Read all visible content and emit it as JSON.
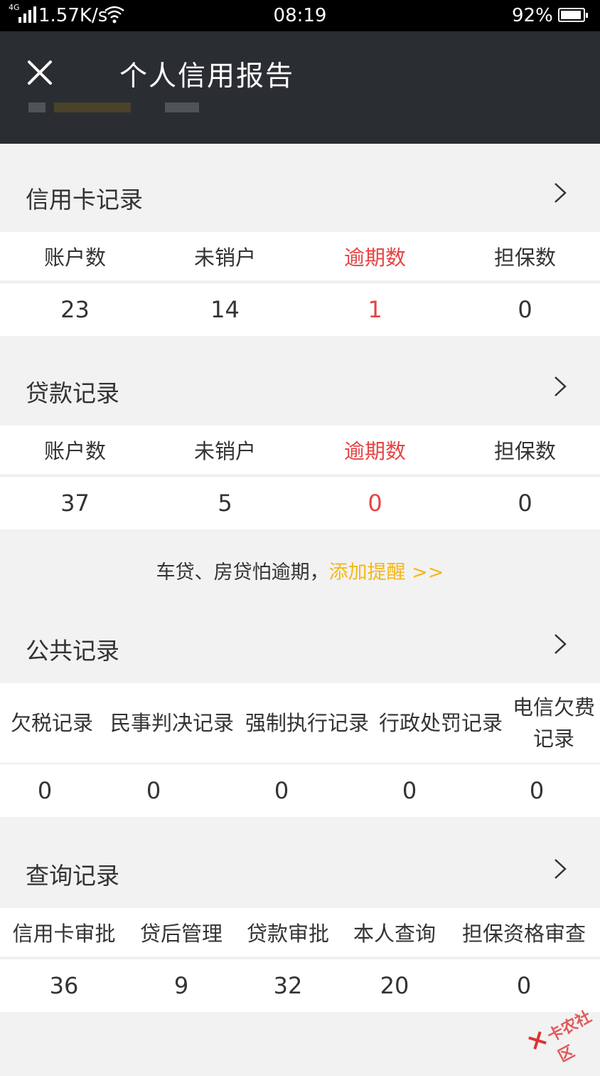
{
  "status": {
    "network": "4G",
    "speed": "1.57K/s",
    "time": "08:19",
    "battery": "92%",
    "battery_level": 0.92
  },
  "header": {
    "title": "个人信用报告"
  },
  "credit_card": {
    "title": "信用卡记录",
    "columns": [
      "账户数",
      "未销户",
      "逾期数",
      "担保数"
    ],
    "values": [
      "23",
      "14",
      "1",
      "0"
    ]
  },
  "loan": {
    "title": "贷款记录",
    "columns": [
      "账户数",
      "未销户",
      "逾期数",
      "担保数"
    ],
    "values": [
      "37",
      "5",
      "0",
      "0"
    ]
  },
  "reminder": {
    "text": "车贷、房贷怕逾期，",
    "link": "添加提醒 >>"
  },
  "public": {
    "title": "公共记录",
    "columns": [
      "欠税记录",
      "民事判决记录",
      "强制执行记录",
      "行政处罚记录",
      "电信欠费记录"
    ],
    "values": [
      "0",
      "0",
      "0",
      "0",
      "0"
    ]
  },
  "query": {
    "title": "查询记录",
    "columns": [
      "信用卡审批",
      "贷后管理",
      "贷款审批",
      "本人查询",
      "担保资格审查"
    ],
    "values": [
      "36",
      "9",
      "32",
      "20",
      "0"
    ]
  },
  "colors": {
    "header_bg": "#2a2e33",
    "overdue_red": "#e64545",
    "link_orange": "#f5b71c"
  },
  "watermark": "卡农社区"
}
